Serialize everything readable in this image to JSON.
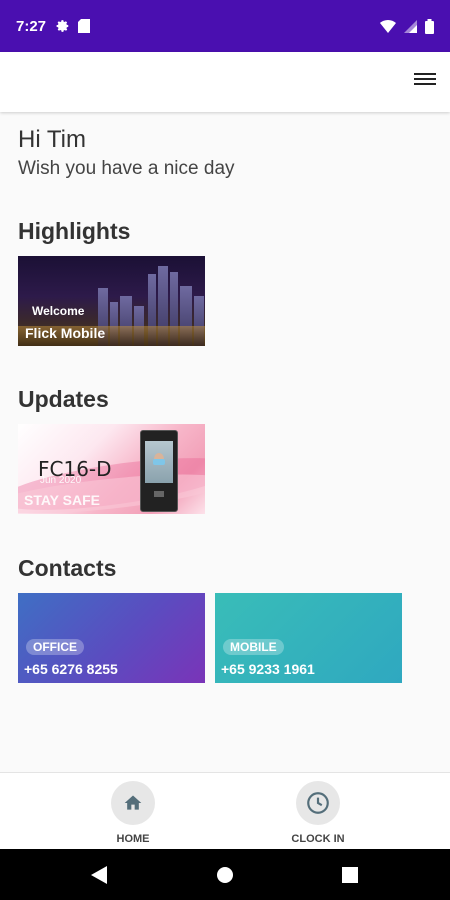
{
  "status_bar": {
    "time": "7:27"
  },
  "header": {
    "menu_icon": "hamburger-menu-icon"
  },
  "greeting": {
    "title": "Hi Tim",
    "subtitle": "Wish you have a nice day"
  },
  "highlights": {
    "title": "Highlights",
    "card": {
      "eyebrow": "Welcome",
      "name": "Flick Mobile"
    }
  },
  "updates": {
    "title": "Updates",
    "card": {
      "product": "FC16-D",
      "date": "Jun 2020",
      "tagline": "STAY SAFE"
    }
  },
  "contacts": {
    "title": "Contacts",
    "items": [
      {
        "label": "OFFICE",
        "number": "+65 6276 8255",
        "color": "#5b4cc0"
      },
      {
        "label": "MOBILE",
        "number": "+65 9233 1961",
        "color": "#39bdb8"
      }
    ]
  },
  "bottom_nav": {
    "items": [
      {
        "label": "HOME",
        "icon": "home-icon"
      },
      {
        "label": "CLOCK IN",
        "icon": "clock-icon"
      }
    ]
  },
  "colors": {
    "primary": "#4a0fb0"
  }
}
